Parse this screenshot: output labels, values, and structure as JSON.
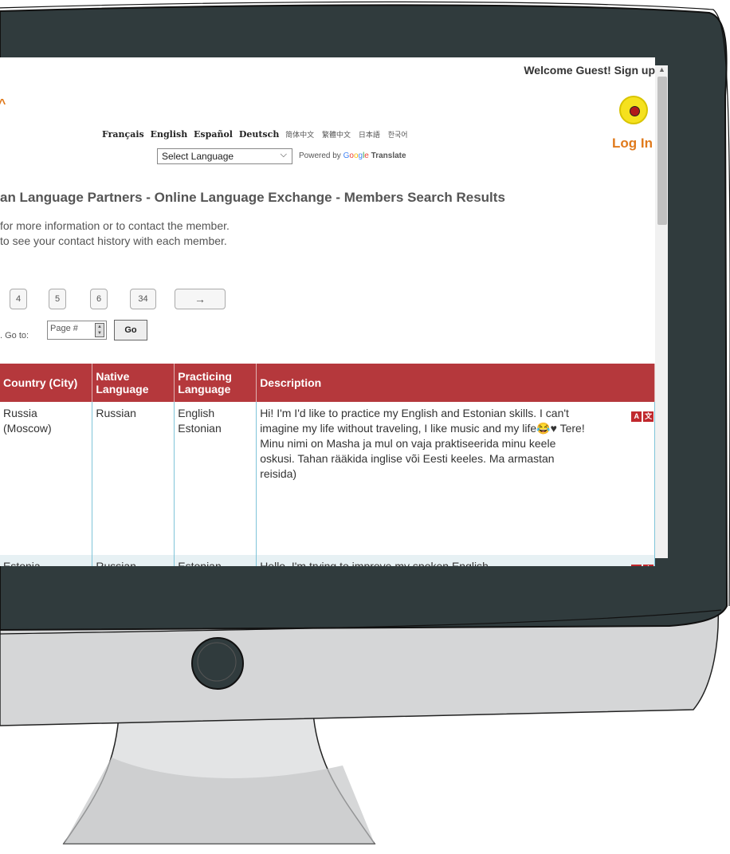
{
  "header": {
    "welcome": "Welcome Guest! Sign up",
    "login": "Log In"
  },
  "languages": {
    "links": [
      "Français",
      "English",
      "Español",
      "Deutsch"
    ],
    "cjk": [
      "简体中文",
      "繁體中文",
      "日本語",
      "한국어"
    ],
    "select": "Select Language",
    "powered_prefix": "Powered by",
    "powered_suffix": "Translate"
  },
  "page": {
    "title": "an Language Partners - Online Language Exchange - Members Search Results",
    "intro_1": "for more information or to contact the member.",
    "intro_2": "to see your contact history with each member."
  },
  "pager": {
    "pages": [
      "4",
      "5",
      "6",
      "34"
    ],
    "next": "→",
    "goto_label": ". Go to:",
    "page_placeholder": "Page #",
    "go": "Go"
  },
  "table": {
    "headers": {
      "country": "Country (City)",
      "native": "Native Language",
      "practicing": "Practicing Language",
      "description": "Description"
    },
    "rows": [
      {
        "country": "Russia",
        "city": "(Moscow)",
        "native": "Russian",
        "practicing_1": "English",
        "practicing_2": "Estonian",
        "description": "Hi! I'm              I'd like to practice my English and Estonian skills. I can't imagine my life without traveling, I like music and my life😂♥ Tere! Minu nimi on Masha ja mul on vaja praktiseerida minu keele oskusi. Tahan rääkida inglise või Eesti keeles. Ma armastan reisida)"
      },
      {
        "country": "Estonia",
        "native": "Russian",
        "practicing_1": "Estonian",
        "description": "Hello, I'm trying to improve my spoken English"
      }
    ]
  },
  "colors": {
    "header_red": "#b5383c",
    "brand_orange": "#e07a1c",
    "monitor_dark": "#303b3d",
    "stand_gray": "#d9dadb"
  }
}
